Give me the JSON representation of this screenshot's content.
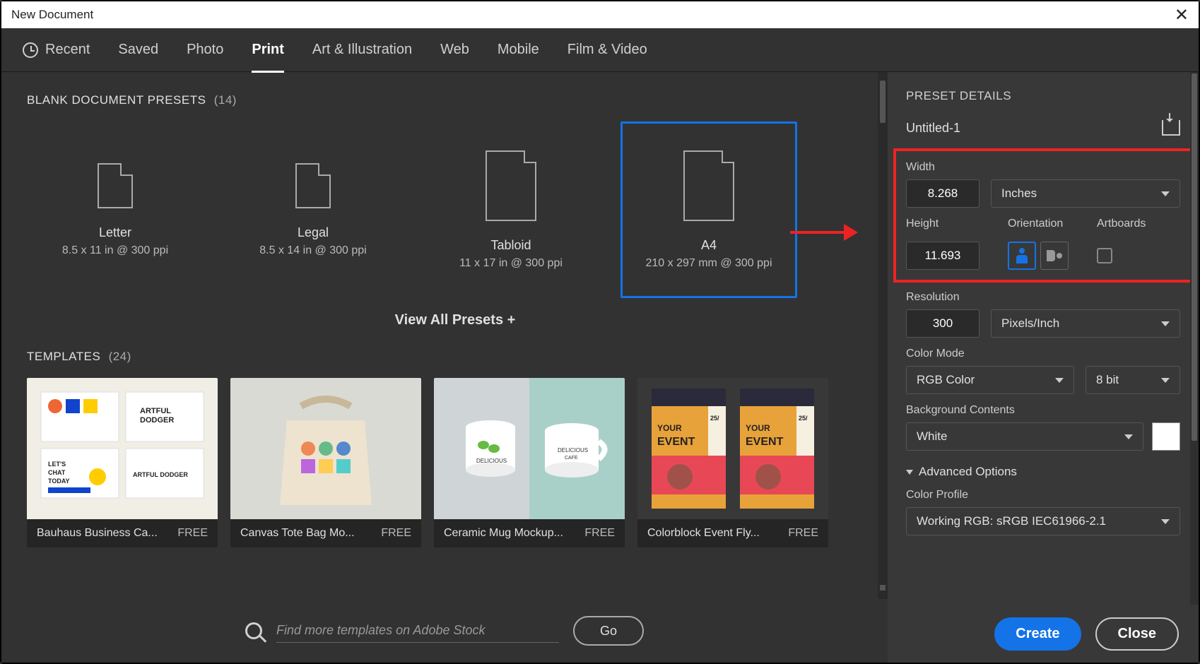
{
  "window_title": "New Document",
  "tabs": [
    "Recent",
    "Saved",
    "Photo",
    "Print",
    "Art & Illustration",
    "Web",
    "Mobile",
    "Film & Video"
  ],
  "active_tab": "Print",
  "presets_header": "BLANK DOCUMENT PRESETS",
  "presets_count": "(14)",
  "presets": [
    {
      "name": "Letter",
      "dim": "8.5 x 11 in @ 300 ppi"
    },
    {
      "name": "Legal",
      "dim": "8.5 x 14 in @ 300 ppi"
    },
    {
      "name": "Tabloid",
      "dim": "11 x 17 in @ 300 ppi"
    },
    {
      "name": "A4",
      "dim": "210 x 297 mm @ 300 ppi"
    }
  ],
  "selected_preset": "A4",
  "view_all": "View All Presets +",
  "templates_header": "TEMPLATES",
  "templates_count": "(24)",
  "templates": [
    {
      "name": "Bauhaus Business Ca...",
      "price": "FREE"
    },
    {
      "name": "Canvas Tote Bag Mo...",
      "price": "FREE"
    },
    {
      "name": "Ceramic Mug Mockup...",
      "price": "FREE"
    },
    {
      "name": "Colorblock Event Fly...",
      "price": "FREE"
    }
  ],
  "search_placeholder": "Find more templates on Adobe Stock",
  "go_label": "Go",
  "details": {
    "title": "PRESET DETAILS",
    "doc_name": "Untitled-1",
    "width_label": "Width",
    "width_value": "8.268",
    "unit": "Inches",
    "height_label": "Height",
    "height_value": "11.693",
    "orientation_label": "Orientation",
    "artboards_label": "Artboards",
    "resolution_label": "Resolution",
    "resolution_value": "300",
    "resolution_unit": "Pixels/Inch",
    "colormode_label": "Color Mode",
    "colormode_value": "RGB Color",
    "bitdepth": "8 bit",
    "bg_label": "Background Contents",
    "bg_value": "White",
    "advanced_label": "Advanced Options",
    "profile_label": "Color Profile",
    "profile_value": "Working RGB: sRGB IEC61966-2.1"
  },
  "create_label": "Create",
  "close_label": "Close"
}
